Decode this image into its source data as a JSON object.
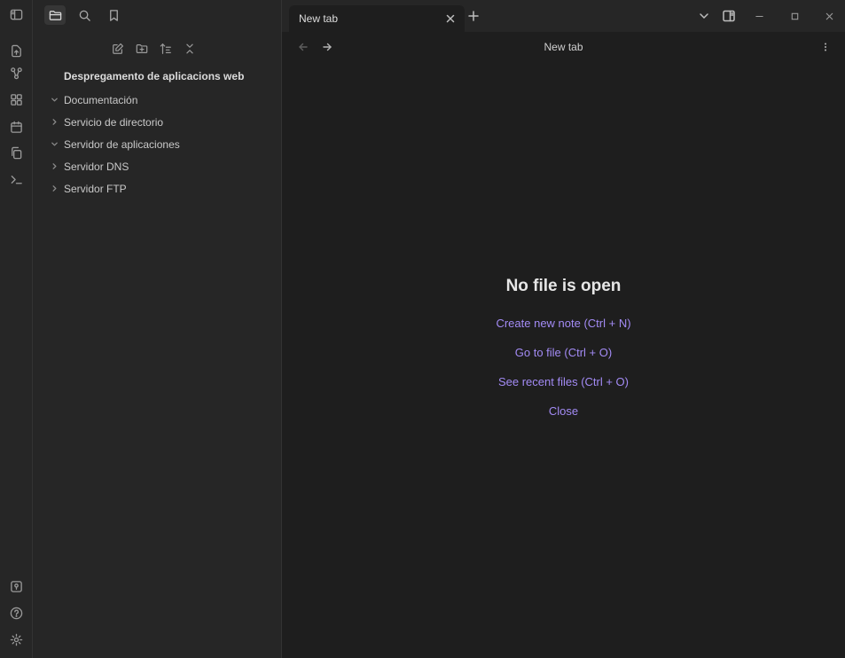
{
  "sidebar": {
    "vault_name": "Despregamento de aplicacions web",
    "items": [
      {
        "label": "Documentación",
        "expanded": true
      },
      {
        "label": "Servicio de directorio",
        "expanded": false
      },
      {
        "label": "Servidor de aplicaciones",
        "expanded": true
      },
      {
        "label": "Servidor DNS",
        "expanded": false
      },
      {
        "label": "Servidor FTP",
        "expanded": false
      }
    ]
  },
  "tabbar": {
    "active_tab": "New tab"
  },
  "view": {
    "title": "New tab"
  },
  "empty_state": {
    "heading": "No file is open",
    "actions": [
      "Create new note (Ctrl + N)",
      "Go to file (Ctrl + O)",
      "See recent files (Ctrl + O)",
      "Close"
    ]
  },
  "colors": {
    "accent": "#a38bf5",
    "background": "#1e1e1e",
    "panel": "#262626"
  }
}
